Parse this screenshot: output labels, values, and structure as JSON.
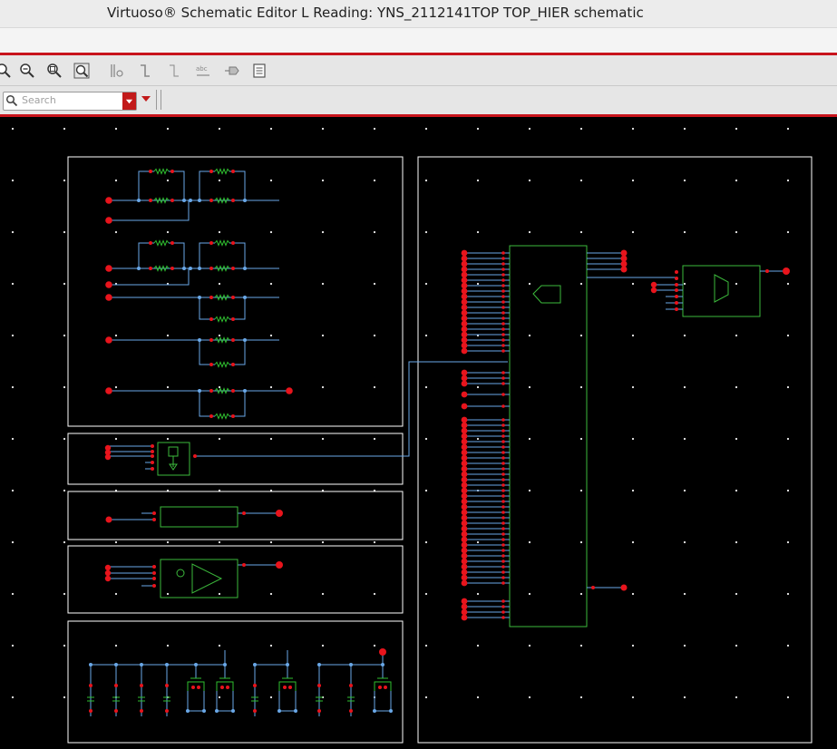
{
  "window": {
    "title": "Virtuoso® Schematic Editor L Reading: YNS_2112141TOP TOP_HIER schematic"
  },
  "toolbar": {
    "icons": [
      "zoom-in-icon",
      "zoom-out-icon",
      "zoom-fit-icon",
      "zoom-select-icon",
      "bus-icon",
      "wire-icon",
      "wire-narrow-icon",
      "label-abc-icon",
      "pin-icon",
      "property-icon"
    ]
  },
  "search": {
    "placeholder": "Search",
    "value": ""
  },
  "colors": {
    "accent": "#c8141c",
    "wire": "#6aa8e8",
    "outline": "#3cba3c",
    "pin": "#e8141c",
    "resistor": "#2fc02f",
    "border": "#ffffff"
  }
}
